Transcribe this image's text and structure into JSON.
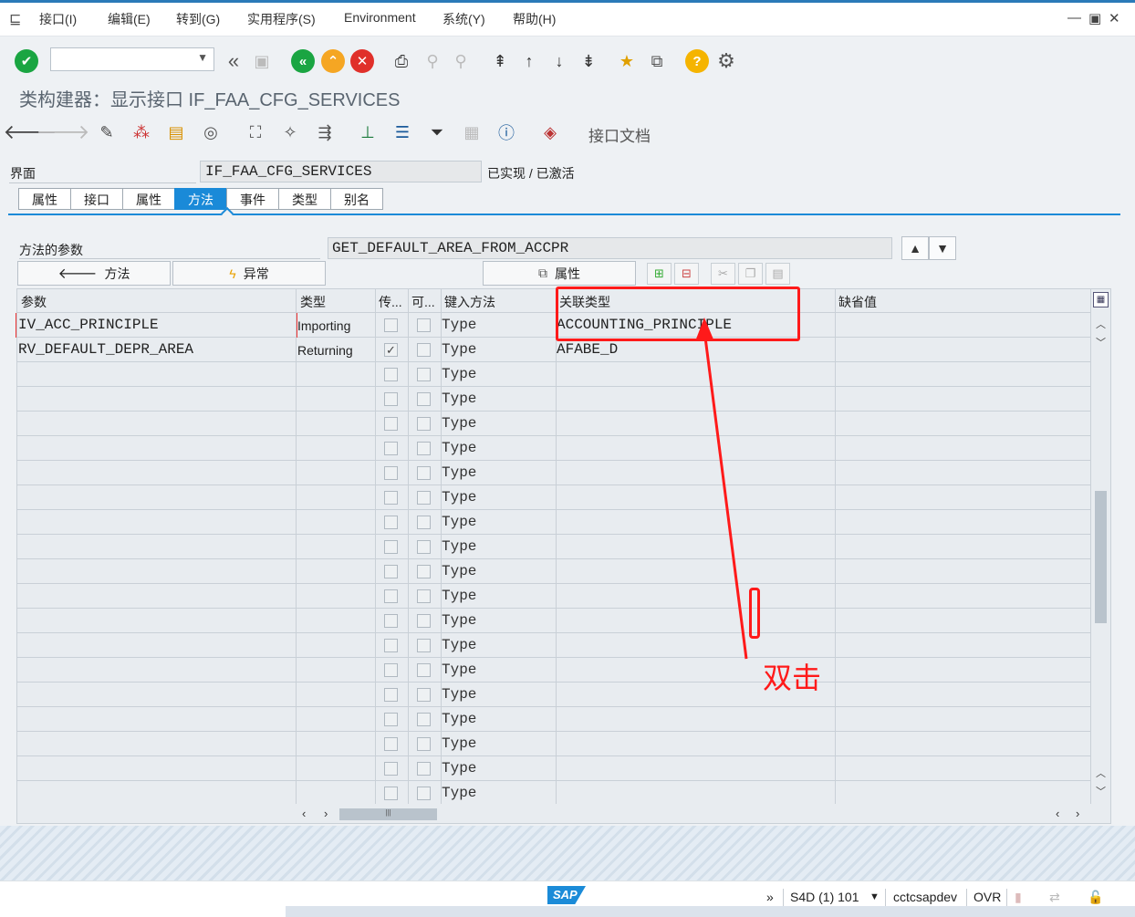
{
  "menu": {
    "items": [
      "接口(I)",
      "编辑(E)",
      "转到(G)",
      "实用程序(S)",
      "Environment",
      "系统(Y)",
      "帮助(H)"
    ]
  },
  "window_controls": [
    "minimize-icon",
    "maximize-icon",
    "close-icon"
  ],
  "screen_title": "类构建器：显示接口 IF_FAA_CFG_SERVICES",
  "toolbar": {
    "doc_label": "接口文档"
  },
  "interface": {
    "label": "界面",
    "name": "IF_FAA_CFG_SERVICES",
    "status": "已实现 / 已激活"
  },
  "tabs": [
    {
      "label": "属性",
      "active": false
    },
    {
      "label": "接口",
      "active": false
    },
    {
      "label": "属性",
      "active": false
    },
    {
      "label": "方法",
      "active": true
    },
    {
      "label": "事件",
      "active": false
    },
    {
      "label": "类型",
      "active": false
    },
    {
      "label": "别名",
      "active": false
    }
  ],
  "params_section": {
    "label": "方法的参数",
    "method": "GET_DEFAULT_AREA_FROM_ACCPR",
    "methods_button": "方法",
    "exceptions_button": "异常",
    "attributes_button": "属性"
  },
  "grid": {
    "headers": [
      "参数",
      "类型",
      "传...",
      "可...",
      "键入方法",
      "关联类型",
      "缺省值"
    ],
    "rows": [
      {
        "param": "IV_ACC_PRINCIPLE",
        "type": "Importing",
        "pass_by_value": false,
        "optional": false,
        "typing": "Type",
        "ref_type": "ACCOUNTING_PRINCIPLE"
      },
      {
        "param": "RV_DEFAULT_DEPR_AREA",
        "type": "Returning",
        "pass_by_value": true,
        "optional": false,
        "typing": "Type",
        "ref_type": "AFABE_D"
      },
      {
        "param": "",
        "type": "",
        "typing": "Type",
        "ref_type": ""
      },
      {
        "param": "",
        "type": "",
        "typing": "Type",
        "ref_type": ""
      },
      {
        "param": "",
        "type": "",
        "typing": "Type",
        "ref_type": ""
      },
      {
        "param": "",
        "type": "",
        "typing": "Type",
        "ref_type": ""
      },
      {
        "param": "",
        "type": "",
        "typing": "Type",
        "ref_type": ""
      },
      {
        "param": "",
        "type": "",
        "typing": "Type",
        "ref_type": ""
      },
      {
        "param": "",
        "type": "",
        "typing": "Type",
        "ref_type": ""
      },
      {
        "param": "",
        "type": "",
        "typing": "Type",
        "ref_type": ""
      },
      {
        "param": "",
        "type": "",
        "typing": "Type",
        "ref_type": ""
      },
      {
        "param": "",
        "type": "",
        "typing": "Type",
        "ref_type": ""
      },
      {
        "param": "",
        "type": "",
        "typing": "Type",
        "ref_type": ""
      },
      {
        "param": "",
        "type": "",
        "typing": "Type",
        "ref_type": ""
      },
      {
        "param": "",
        "type": "",
        "typing": "Type",
        "ref_type": ""
      },
      {
        "param": "",
        "type": "",
        "typing": "Type",
        "ref_type": ""
      },
      {
        "param": "",
        "type": "",
        "typing": "Type",
        "ref_type": ""
      },
      {
        "param": "",
        "type": "",
        "typing": "Type",
        "ref_type": ""
      },
      {
        "param": "",
        "type": "",
        "typing": "Type",
        "ref_type": ""
      },
      {
        "param": "",
        "type": "",
        "typing": "Type",
        "ref_type": ""
      }
    ]
  },
  "annotation": {
    "text": "双击",
    "color": "#ff1a1a"
  },
  "status_bar": {
    "logo": "SAP",
    "system": "S4D (1) 101",
    "host": "cctcsapdev",
    "mode": "OVR"
  },
  "colors": {
    "accent": "#1a8ad8",
    "ok_green": "#1aa542",
    "cancel_red": "#e0302a",
    "exit_orange": "#f5a623",
    "help_yellow": "#f5b400"
  }
}
